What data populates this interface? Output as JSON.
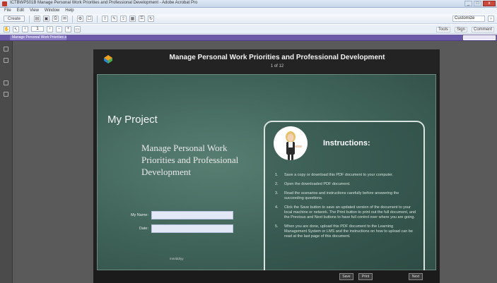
{
  "window": {
    "title": "ICTBWP501B Manage Personal Work Priorities and Professional Development - Adobe Acrobat Pro",
    "min": "_",
    "max": "□",
    "close": "x"
  },
  "menubar": {
    "items": [
      "File",
      "Edit",
      "View",
      "Window",
      "Help"
    ]
  },
  "toolbar": {
    "create_label": "Create",
    "page_num": "1",
    "signin_label": "Customize"
  },
  "toolbar2": {
    "links": [
      "Tools",
      "Sign",
      "Comment"
    ]
  },
  "doc_tab": {
    "label": "Manage Personal Work Priorities and Professional Development"
  },
  "page": {
    "title": "Manage Personal Work Priorities and Professional Development",
    "page_of": "1 of 12",
    "my_project": "My Project",
    "subtitle": "Manage Personal Work Priorities and Professional Development",
    "form": {
      "name_label": "My Name:",
      "date_label": "Date:",
      "date_hint": "mm/dd/yy",
      "name_value": "",
      "date_value": ""
    },
    "instructions": {
      "title": "Instructions:",
      "steps": [
        "Save a copy or download this PDF document to your computer.",
        "Open the downloaded PDF document.",
        "Read the scenarios and instructions carefully before answering the succeeding questions.",
        "Click the Save button to save an updated version of the document to your local machine or network. The Print button to print out the full document, and the Previous and Next buttons to have full control over where you are going.",
        "When you are done, upload this PDF document to the Learning Management System or LMS and the instructions on how to upload can be read at the last page of this document."
      ]
    },
    "footer": {
      "save_label": "Save",
      "print_label": "Print",
      "next_label": "Next"
    }
  }
}
